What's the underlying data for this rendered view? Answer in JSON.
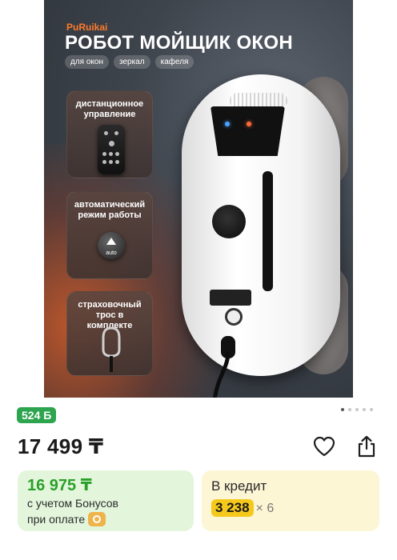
{
  "product_image": {
    "brand": "PuRuikai",
    "title": "РОБОТ МОЙЩИК ОКОН",
    "chips": [
      "для окон",
      "зеркал",
      "кафеля"
    ],
    "features": [
      "дистанционное управление",
      "автоматический режим работы",
      "страховочный трос в комплекте"
    ],
    "auto_button_label": "auto"
  },
  "pagination": {
    "total": 5,
    "active_index": 0
  },
  "bonus_badge": "524 Б",
  "price": "17 499 ₸",
  "actions": {
    "favorite_icon": "heart-icon",
    "share_icon": "share-icon"
  },
  "bonus_offer": {
    "price": "16 975 ₸",
    "line1": "с учетом Бонусов",
    "line2": "при оплате"
  },
  "credit_offer": {
    "title": "В кредит",
    "amount": "3 238",
    "multiplier": "× 6"
  },
  "colors": {
    "bonus_green": "#2da44e",
    "bonus_card_bg": "#e3f6dc",
    "credit_card_bg": "#fdf6d5",
    "credit_highlight": "#f5c91c",
    "brand_orange": "#ff7a2a"
  }
}
